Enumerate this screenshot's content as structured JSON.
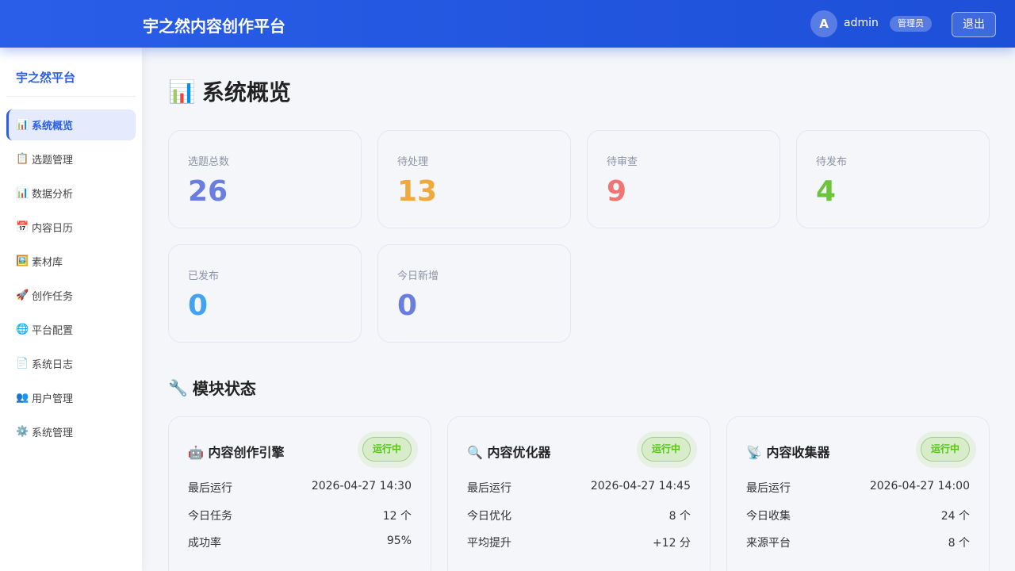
{
  "header": {
    "title": "宇之然内容创作平台",
    "avatar_letter": "A",
    "username": "admin",
    "role": "管理员",
    "logout_label": "退出"
  },
  "sidebar": {
    "brand": "宇之然平台",
    "items": [
      {
        "icon": "📊",
        "icon_name": "bar-chart-icon",
        "label": "系统概览",
        "active": true
      },
      {
        "icon": "📋",
        "icon_name": "clipboard-icon",
        "label": "选题管理"
      },
      {
        "icon": "📊",
        "icon_name": "bar-chart-icon",
        "label": "数据分析"
      },
      {
        "icon": "📅",
        "icon_name": "calendar-icon",
        "label": "内容日历"
      },
      {
        "icon": "🖼️",
        "icon_name": "picture-icon",
        "label": "素材库"
      },
      {
        "icon": "🚀",
        "icon_name": "rocket-icon",
        "label": "创作任务"
      },
      {
        "icon": "🌐",
        "icon_name": "globe-icon",
        "label": "平台配置"
      },
      {
        "icon": "📄",
        "icon_name": "document-icon",
        "label": "系统日志"
      },
      {
        "icon": "👥",
        "icon_name": "users-icon",
        "label": "用户管理"
      },
      {
        "icon": "⚙️",
        "icon_name": "gear-icon",
        "label": "系统管理"
      }
    ]
  },
  "main": {
    "title_icon": "📊",
    "title": "系统概览",
    "stats": [
      {
        "label": "选题总数",
        "value": "26",
        "color": "#6a7ee0"
      },
      {
        "label": "待处理",
        "value": "13",
        "color": "#f0a93c"
      },
      {
        "label": "待审查",
        "value": "9",
        "color": "#f07474"
      },
      {
        "label": "待发布",
        "value": "4",
        "color": "#6cc43c"
      },
      {
        "label": "已发布",
        "value": "0",
        "color": "#43a3f2"
      },
      {
        "label": "今日新增",
        "value": "0",
        "color": "#6a7ee0"
      }
    ],
    "modules_title_icon": "🔧",
    "modules_title": "模块状态",
    "modules": [
      {
        "icon": "🤖",
        "name": "内容创作引擎",
        "status": "运行中",
        "rows": [
          {
            "k": "最后运行",
            "v": "2026-04-27 14:30"
          },
          {
            "k": "今日任务",
            "v": "12 个"
          },
          {
            "k": "成功率",
            "v": "95%"
          }
        ]
      },
      {
        "icon": "🔍",
        "name": "内容优化器",
        "status": "运行中",
        "rows": [
          {
            "k": "最后运行",
            "v": "2026-04-27 14:45"
          },
          {
            "k": "今日优化",
            "v": "8 个"
          },
          {
            "k": "平均提升",
            "v": "+12 分"
          }
        ]
      },
      {
        "icon": "📡",
        "name": "内容收集器",
        "status": "运行中",
        "rows": [
          {
            "k": "最后运行",
            "v": "2026-04-27 14:00"
          },
          {
            "k": "今日收集",
            "v": "24 个"
          },
          {
            "k": "来源平台",
            "v": "8 个"
          }
        ]
      }
    ]
  },
  "colors": {
    "accent": "#2a5ee8",
    "status_green": "#52c41a"
  }
}
